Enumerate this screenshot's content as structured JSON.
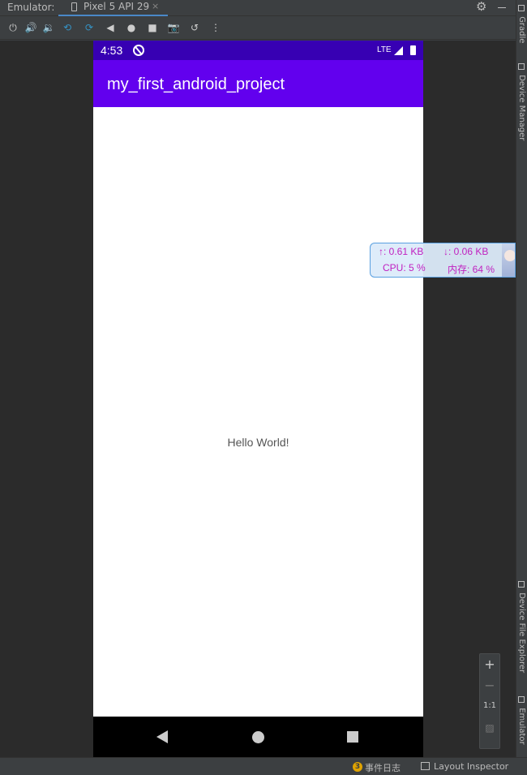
{
  "tabbar": {
    "label": "Emulator:",
    "tab_name": "Pixel 5 API 29",
    "close": "×"
  },
  "toolbar": {
    "icons": [
      "power-icon",
      "volume-up-icon",
      "volume-down-icon",
      "rotate-left-icon",
      "rotate-right-icon",
      "back-icon",
      "home-icon",
      "overview-icon",
      "screenshot-icon",
      "snapshot-icon",
      "more-icon"
    ]
  },
  "device": {
    "status_time": "4:53",
    "network": "LTE",
    "app_title": "my_first_android_project",
    "hello": "Hello World!"
  },
  "netmon": {
    "upload": "↑: 0.61 KB",
    "download": "↓: 0.06 KB",
    "cpu": "CPU: 5 %",
    "memory": "内存: 64 %"
  },
  "right_panel": {
    "gradle": "Gradle",
    "device_manager": "Device Manager",
    "device_file_explorer": "Device File Explorer",
    "emulator": "Emulator"
  },
  "zoom": {
    "zoom_in": "+",
    "zoom_out": "−",
    "one_to_one": "1:1"
  },
  "bottombar": {
    "event_count": "3",
    "event_log": "事件日志",
    "layout_inspector": "Layout Inspector"
  }
}
